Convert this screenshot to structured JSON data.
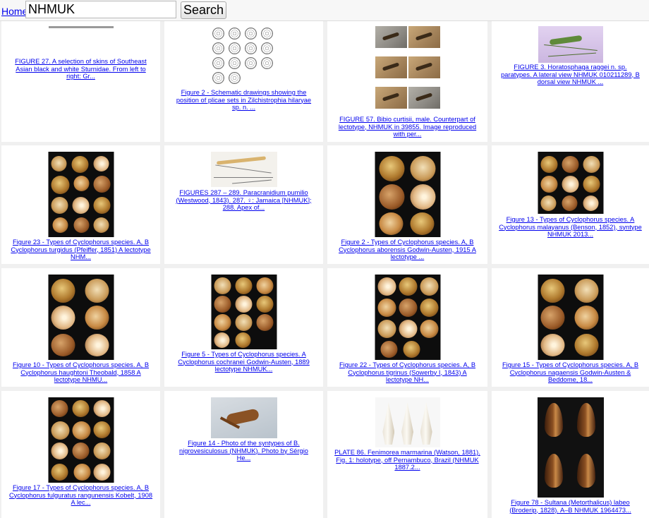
{
  "header": {
    "home_link": "Home",
    "search_value": "NHMUK",
    "search_button": "Search"
  },
  "results": [
    {
      "caption": "FIGURE 27. A selection of skins of Southeast Asian black and white Sturnidae. From left to right: Gr..."
    },
    {
      "caption": "Figure 2 - Schematic drawings showing the position of plicae sets in Zilchistrophia hilaryae sp. n. ..."
    },
    {
      "caption": "FIGURE 57. Bibio curtisii, male. Counterpart of lectotype, NHMUK in 39855. Image reproduced with per..."
    },
    {
      "caption": "FIGURE 3. Horatosphaga raggei n. sp. paratypes. A lateral view NHMUK 010211289, B dorsal view NHMUK ..."
    },
    {
      "caption": "Figure 23 - Types of Cyclophorus species. A, B Cyclophorus turgidus (Pfeiffer, 1851) A lectotype NHM..."
    },
    {
      "caption": "FIGURES 287 – 289. Paracranidium pumilio (Westwood, 1843). 287. ♀: Jamaica [NHMUK]; 288. Apex of..."
    },
    {
      "caption": "Figure 2 - Types of Cyclophorus species. A, B Cyclophorus aborensis Godwin-Austen, 1915 A lectotype ..."
    },
    {
      "caption": "Figure 13 - Types of Cyclophorus species. A Cyclophorus malayanus (Benson, 1852), syntype NHMUK 2013..."
    },
    {
      "caption": "Figure 10 - Types of Cyclophorus species. A, B Cyclophorus haughtoni Theobald, 1858 A lectotype NHMU..."
    },
    {
      "caption": "Figure 5 - Types of Cyclophorus species. A Cyclophorus cochranei Godwin-Austen, 1889 lectotype NHMUK..."
    },
    {
      "caption": "Figure 22 - Types of Cyclophorus species. A, B Cyclophorus tigrinus (Sowerby I, 1843) A lectotype NH..."
    },
    {
      "caption": "Figure 15 - Types of Cyclophorus species. A, B Cyclophorus nagaensis Godwin-Austen & Beddome, 18..."
    },
    {
      "caption": "Figure 17 - Types of Cyclophorus species. A, B Cyclophorus fulguratus rangunensis Kobelt, 1908 A lec..."
    },
    {
      "caption": "Figure 14 - Photo of the syntypes of B. nigrovesiculosus (NHMUK). Photo by Sérgio He..."
    },
    {
      "caption": "PLATE 86. Fenimorea marmarina (Watson, 1881). Fig. 1: holotype, off Pernambuco, Brazil (NHMUK 1887.2..."
    },
    {
      "caption": "Figure 78 - Sultana (Metorthalicus) labeo (Broderip, 1828). A–B NHMUK 1964473..."
    }
  ]
}
